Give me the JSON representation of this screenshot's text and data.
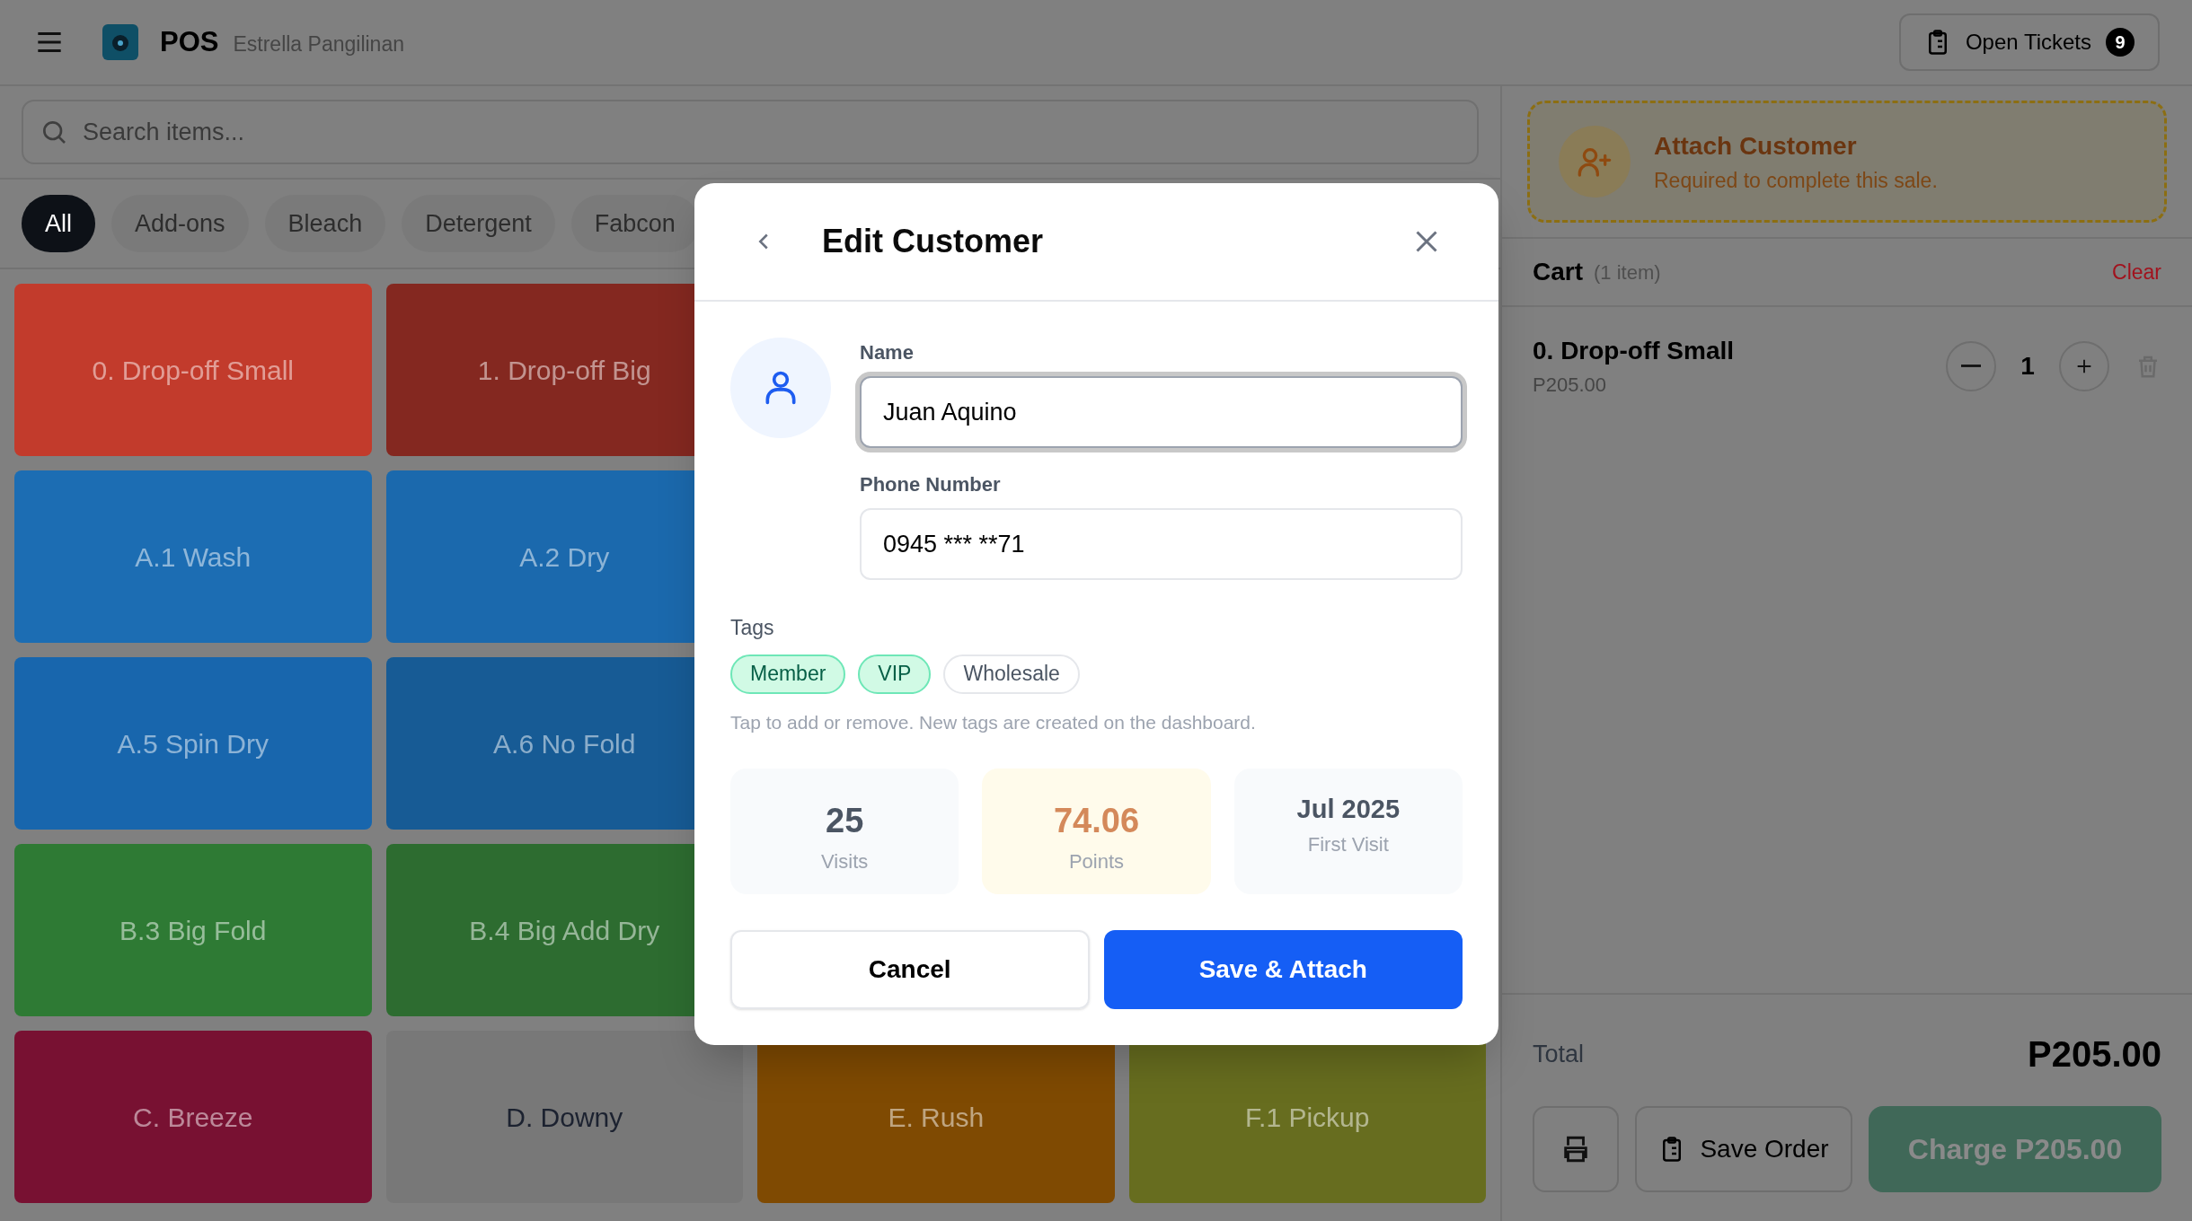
{
  "header": {
    "app_name": "POS",
    "user": "Estrella Pangilinan",
    "open_tickets": {
      "label": "Open Tickets",
      "count": "9"
    }
  },
  "search": {
    "placeholder": "Search items..."
  },
  "categories": [
    {
      "label": "All",
      "selected": true
    },
    {
      "label": "Add-ons",
      "selected": false
    },
    {
      "label": "Bleach",
      "selected": false
    },
    {
      "label": "Detergent",
      "selected": false
    },
    {
      "label": "Fabcon",
      "selected": false
    }
  ],
  "tile_rows": [
    [
      {
        "label": "0. Drop-off Small",
        "color": "#c23b2c"
      },
      {
        "label": "1. Drop-off Big",
        "color": "#842820"
      }
    ],
    [
      {
        "label": "A.1 Wash",
        "color": "#1c6db3"
      },
      {
        "label": "A.2 Dry",
        "color": "#1b69ad"
      }
    ],
    [
      {
        "label": "A.5 Spin Dry",
        "color": "#1866ad"
      },
      {
        "label": "A.6 No Fold",
        "color": "#175b95"
      }
    ],
    [
      {
        "label": "B.3 Big Fold",
        "color": "#2e7a34"
      },
      {
        "label": "B.4 Big Add Dry",
        "color": "#2d6c30"
      }
    ],
    [
      {
        "label": "C. Breeze",
        "color": "#781132"
      },
      {
        "label": "D. Downy",
        "color": "#787878"
      },
      {
        "label": "E. Rush",
        "color": "#7f4a02"
      },
      {
        "label": "F.1 Pickup",
        "color": "#676d1f"
      }
    ]
  ],
  "customer_banner": {
    "title": "Attach Customer",
    "subtitle": "Required to complete this sale."
  },
  "cart": {
    "title": "Cart",
    "count": "(1 item)",
    "clear": "Clear",
    "items": [
      {
        "name": "0. Drop-off Small",
        "price": "P205.00",
        "quantity": "1"
      }
    ],
    "total_label": "Total",
    "total": "P205.00",
    "save_order": "Save Order",
    "charge": "Charge P205.00",
    "charge_disabled": true
  },
  "modal": {
    "title": "Edit Customer",
    "fields": [
      {
        "label": "Name",
        "value": "Juan Aquino",
        "focused": true
      },
      {
        "label": "Phone Number",
        "value": "0945 *** **71",
        "focused": false
      }
    ],
    "tags_label": "Tags",
    "tags": [
      {
        "label": "Member",
        "selected": true
      },
      {
        "label": "VIP",
        "selected": true
      },
      {
        "label": "Wholesale",
        "selected": false
      }
    ],
    "tags_hint": "Tap to add or remove. New tags are created on the dashboard.",
    "stats": [
      {
        "kind": "count",
        "value": "25",
        "label": "Visits"
      },
      {
        "kind": "points",
        "value": "74.06",
        "label": "Points"
      },
      {
        "kind": "date",
        "value": "Jul 2025",
        "label": "First Visit"
      }
    ],
    "cancel": "Cancel",
    "confirm": "Save & Attach"
  }
}
